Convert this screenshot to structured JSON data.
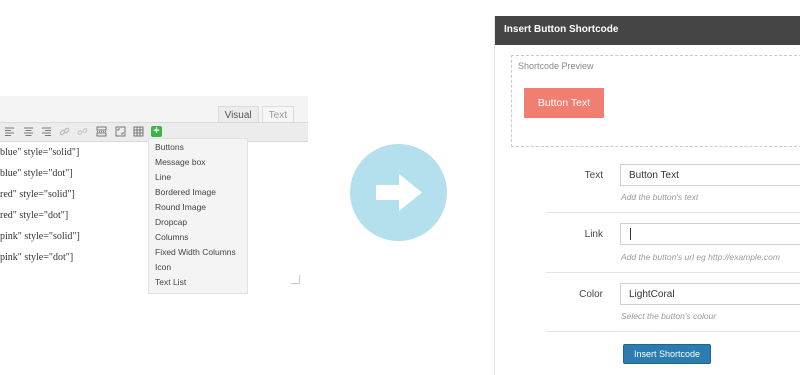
{
  "editor": {
    "tabs": [
      {
        "label": "Visual"
      },
      {
        "label": "Text"
      }
    ],
    "content_lines": [
      "blue\" style=\"solid\"]",
      "blue\" style=\"dot\"]",
      "red\" style=\"solid\"]",
      "red\" style=\"dot\"]",
      "pink\" style=\"solid\"]",
      "pink\" style=\"dot\"]"
    ],
    "toolbar_icons": [
      "align-left-icon",
      "align-center-icon",
      "align-right-icon",
      "link-icon",
      "unlink-icon",
      "insert-more-icon",
      "fullscreen-icon",
      "kitchen-sink-icon",
      "add-shortcode-icon"
    ],
    "dropdown_items": [
      "Buttons",
      "Message box",
      "Line",
      "Bordered Image",
      "Round Image",
      "Dropcap",
      "Columns",
      "Fixed Width Columns",
      "Icon",
      "Text List"
    ]
  },
  "dialog": {
    "title": "Insert Button Shortcode",
    "preview_label": "Shortcode Preview",
    "preview_button_text": "Button Text",
    "fields": {
      "text": {
        "label": "Text",
        "value": "Button Text",
        "help": "Add the button's text"
      },
      "link": {
        "label": "Link",
        "value": "",
        "help": "Add the button's url eg http://example.com"
      },
      "color": {
        "label": "Color",
        "value": "LightCoral",
        "help": "Select the button's colour"
      }
    },
    "insert_button": "Insert Shortcode"
  },
  "colors": {
    "arrow_circle": "#b4dfec",
    "dialog_header": "#454545",
    "preview_button": "#f07f72",
    "insert_button": "#2a7cb1"
  }
}
